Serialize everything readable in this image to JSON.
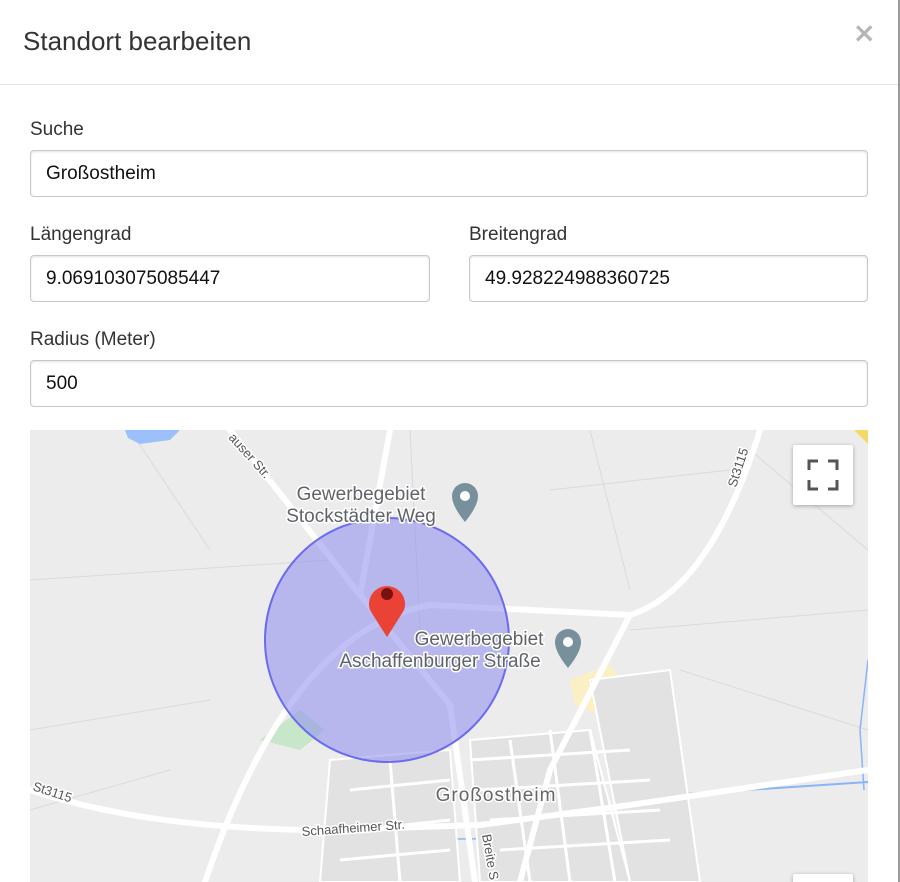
{
  "dialog": {
    "title": "Standort bearbeiten",
    "close_label": "×"
  },
  "form": {
    "search": {
      "label": "Suche",
      "value": "Großostheim"
    },
    "longitude": {
      "label": "Längengrad",
      "value": "9.069103075085447"
    },
    "latitude": {
      "label": "Breitengrad",
      "value": "49.928224988360725"
    },
    "radius": {
      "label": "Radius (Meter)",
      "value": "500"
    }
  },
  "map": {
    "poi_1": {
      "line1": "Gewerbegebiet",
      "line2": "Stockstädter Weg"
    },
    "poi_2": {
      "line1": "Gewerbegebiet",
      "line2": "Aschaffenburger Straße"
    },
    "town": "Großostheim",
    "roads": {
      "hauser": "auser Str.",
      "st3115_top": "St3115",
      "st3115_left": "St3115",
      "schaafheimer": "Schaafheimer Str.",
      "breite": "Breite S"
    },
    "colors": {
      "radius_fill": "#8c8cf0",
      "radius_stroke": "#6b6bf0",
      "marker": "#ea4335",
      "poi_pin": "#78909c"
    },
    "fullscreen_icon": "fullscreen-icon"
  }
}
